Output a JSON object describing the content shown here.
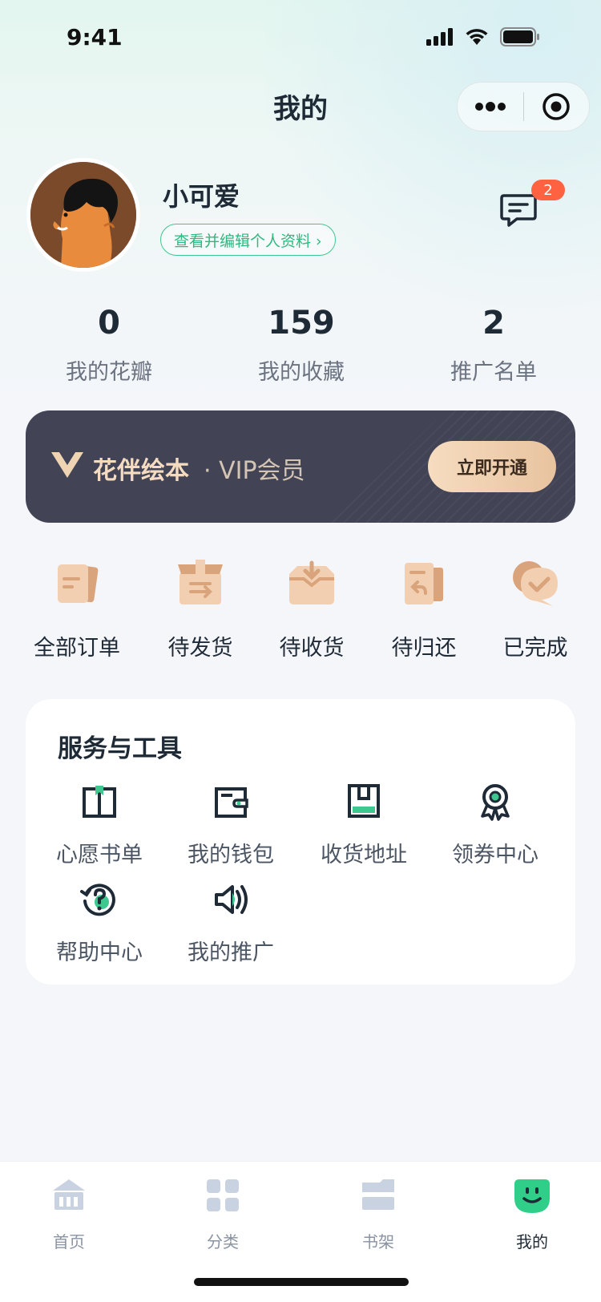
{
  "status_bar": {
    "time": "9:41"
  },
  "nav": {
    "title": "我的"
  },
  "profile": {
    "name": "小可爱",
    "edit_label": "查看并编辑个人资料 ›",
    "message_count": "2"
  },
  "stats": [
    {
      "value": "0",
      "label": "我的花瓣"
    },
    {
      "value": "159",
      "label": "我的收藏"
    },
    {
      "value": "2",
      "label": "推广名单"
    }
  ],
  "vip": {
    "brand": "花伴绘本",
    "subtitle": "· VIP会员",
    "button": "立即开通",
    "colors": {
      "background": "#424456",
      "accent": "#f5dcc0"
    }
  },
  "orders": [
    {
      "label": "全部订单",
      "icon": "order-list-icon"
    },
    {
      "label": "待发货",
      "icon": "box-ship-icon"
    },
    {
      "label": "待收货",
      "icon": "box-receive-icon"
    },
    {
      "label": "待归还",
      "icon": "return-icon"
    },
    {
      "label": "已完成",
      "icon": "check-chat-icon"
    }
  ],
  "services": {
    "title": "服务与工具",
    "items": [
      {
        "label": "心愿书单",
        "icon": "book-icon"
      },
      {
        "label": "我的钱包",
        "icon": "wallet-icon"
      },
      {
        "label": "收货地址",
        "icon": "address-icon"
      },
      {
        "label": "领券中心",
        "icon": "coupon-badge-icon"
      },
      {
        "label": "帮助中心",
        "icon": "help-icon"
      },
      {
        "label": "我的推广",
        "icon": "speaker-icon"
      }
    ]
  },
  "tabbar": [
    {
      "label": "首页",
      "icon": "home-icon"
    },
    {
      "label": "分类",
      "icon": "category-icon"
    },
    {
      "label": "书架",
      "icon": "bookshelf-icon"
    },
    {
      "label": "我的",
      "icon": "profile-face-icon",
      "active": true
    }
  ],
  "colors": {
    "brand_green": "#3ec78f",
    "badge_red": "#ff6241",
    "order_icon": "#e8b58f"
  }
}
